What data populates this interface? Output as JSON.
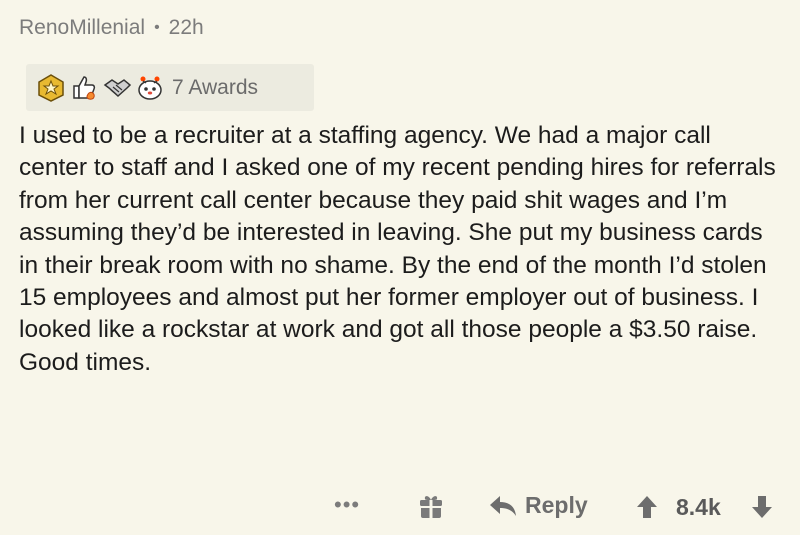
{
  "comment": {
    "author": "RenoMillenial",
    "separator": "•",
    "age": "22h",
    "awards": {
      "icons": [
        "gold-medal-icon",
        "thumbs-up-fire-icon",
        "handshake-icon",
        "wholesome-seal-icon"
      ],
      "label": "7 Awards"
    },
    "body": "I used to be a recruiter at a staffing agency. We had a major call center to staff and I asked one of my recent pending hires for referrals from her current call center because they paid shit wages and I’m assuming they’d be interested in leaving. She put my business cards in their break room with no shame. By the end of the month I’d stolen 15 employees and almost put her former employer out of business. I looked like a rockstar at work and got all those people a $3.50 raise. Good times."
  },
  "actions": {
    "more_label": "•••",
    "reply_label": "Reply",
    "score": "8.4k"
  }
}
